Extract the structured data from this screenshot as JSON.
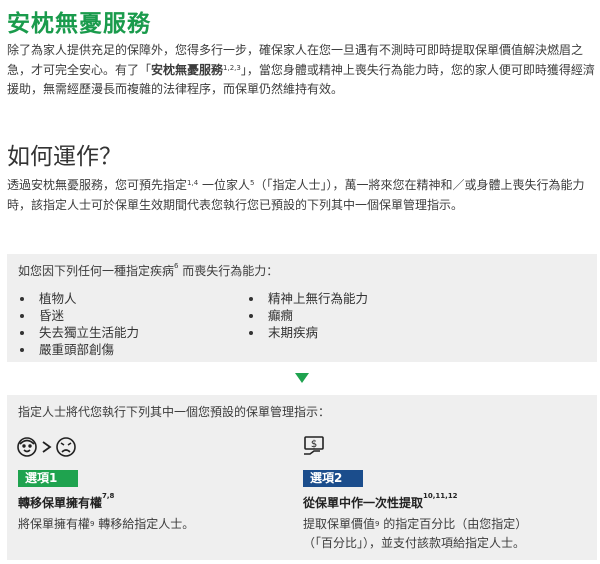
{
  "title": "安枕無憂服務",
  "intro": {
    "text_1": "除了為家人提供充足的保障外，您得多行一步，確保家人在您一旦遇有不測時可即時提取保單價值解決燃眉之急，才可完全安心。有了「",
    "bold": "安枕無憂服務",
    "sup": "1,2,3",
    "text_2": "」，當您身體或精神上喪失行為能力時，您的家人便可即時獲得經濟援助，無需經歷漫長而複雜的法律程序，而保單仍然維持有效。"
  },
  "how": {
    "heading": "如何運作？",
    "text_1": "透過安枕無憂服務，您可預先指定",
    "sup_1": "1,4",
    "text_2": " 一位家人",
    "sup_2": "5",
    "text_3": "（「指定人士」），萬一將來您在精神和／或身體上喪失行為能力時，該指定人士可於保單生效期間代表您執行您已預設的下列其中一個保單管理指示。"
  },
  "illness": {
    "head_1": "如您因下列任何一種指定疾病",
    "head_sup": "6",
    "head_2": " 而喪失行為能力：",
    "col_a": [
      "植物人",
      "昏迷",
      "失去獨立生活能力",
      "嚴重頭部創傷"
    ],
    "col_b": [
      "精神上無行為能力",
      "癲癇",
      "末期疾病"
    ]
  },
  "instructions": {
    "head": "指定人士將代您執行下列其中一個您預設的保單管理指示：",
    "option_1": {
      "badge": "選項1",
      "title": "轉移保單擁有權",
      "title_sup": "7,8",
      "body_1": "將保單擁有權",
      "body_sup": "9",
      "body_2": " 轉移給指定人士。",
      "icons": [
        "owner-face-icon",
        "greater-than-icon",
        "designee-face-icon"
      ]
    },
    "option_2": {
      "badge": "選項2",
      "title": "從保單中作一次性提取",
      "title_sup": "10,11,12",
      "line_1a": "提取保單價值",
      "line_1_sup": "9",
      "line_1b": " 的指定百分比（由您指定）",
      "line_2": "（「百分比」），並支付該款項給指定人士。",
      "icon": "money-withdraw-icon"
    }
  },
  "colors": {
    "green": "#1fa34f",
    "blue": "#1b4d8c",
    "panel": "#efefef"
  }
}
